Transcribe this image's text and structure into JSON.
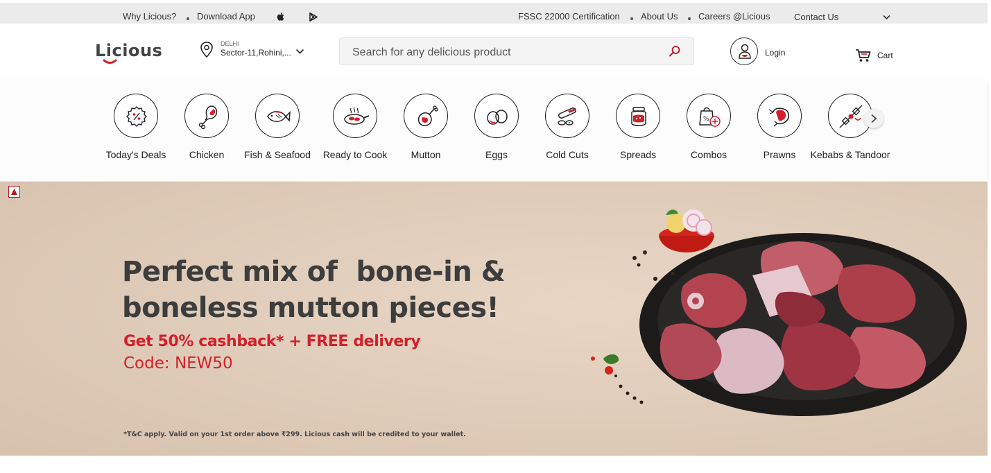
{
  "topbar": {
    "why": "Why Licious?",
    "download": "Download App",
    "fssc": "FSSC 22000 Certification",
    "about": "About Us",
    "careers": "Careers @Licious",
    "contact": "Contact Us"
  },
  "header": {
    "logo_text": "Licious",
    "location_city": "DELHI",
    "location_address": "Sector-11,Rohini,...",
    "search_placeholder": "Search for any delicious product",
    "login": "Login",
    "cart": "Cart"
  },
  "categories": [
    {
      "label": "Today's Deals",
      "icon": "deals-icon"
    },
    {
      "label": "Chicken",
      "icon": "chicken-icon"
    },
    {
      "label": "Fish & Seafood",
      "icon": "fish-icon"
    },
    {
      "label": "Ready to Cook",
      "icon": "ready-to-cook-icon"
    },
    {
      "label": "Mutton",
      "icon": "mutton-icon"
    },
    {
      "label": "Eggs",
      "icon": "eggs-icon"
    },
    {
      "label": "Cold Cuts",
      "icon": "cold-cuts-icon"
    },
    {
      "label": "Spreads",
      "icon": "spreads-icon"
    },
    {
      "label": "Combos",
      "icon": "combos-icon"
    },
    {
      "label": "Prawns",
      "icon": "prawns-icon"
    },
    {
      "label": "Kebabs & Tandoor",
      "icon": "kebabs-icon"
    }
  ],
  "banner": {
    "headline_1": "Perfect mix of  bone-in &",
    "headline_2": "boneless mutton pieces!",
    "offer": "Get 50% cashback* + FREE delivery",
    "code": "Code: NEW50",
    "terms": "*T&C apply. Valid on your 1st order above ₹299. Licious cash will be credited to your wallet."
  },
  "colors": {
    "brand_red": "#d31f2a",
    "banner_bg": "#e2cfbd",
    "topbar_bg": "#ebebeb"
  }
}
